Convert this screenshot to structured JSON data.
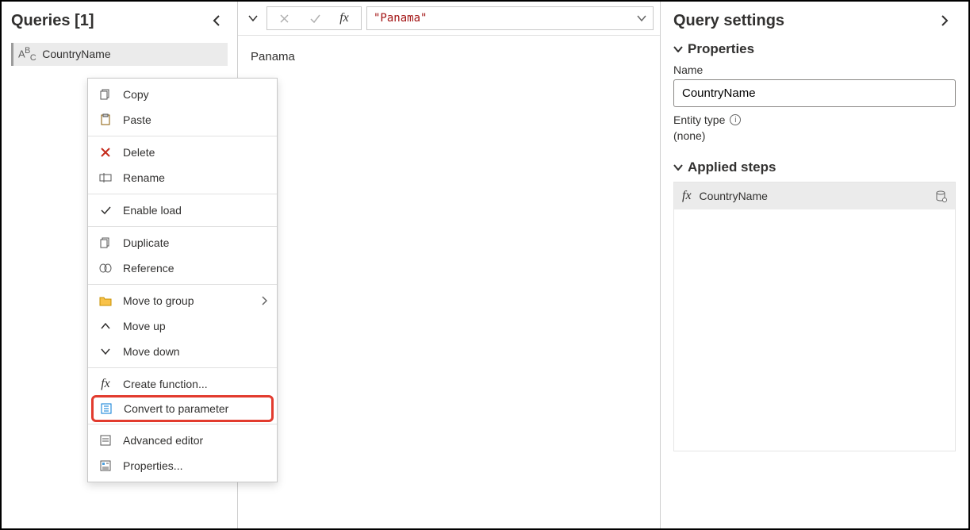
{
  "queries": {
    "title": "Queries [1]",
    "items": [
      {
        "label": "CountryName"
      }
    ]
  },
  "context_menu": {
    "copy": "Copy",
    "paste": "Paste",
    "delete": "Delete",
    "rename": "Rename",
    "enable_load": "Enable load",
    "duplicate": "Duplicate",
    "reference": "Reference",
    "move_to_group": "Move to group",
    "move_up": "Move up",
    "move_down": "Move down",
    "create_function": "Create function...",
    "convert_to_parameter": "Convert to parameter",
    "advanced_editor": "Advanced editor",
    "properties": "Properties..."
  },
  "formula_bar": {
    "text": "\"Panama\""
  },
  "preview": {
    "value": "Panama"
  },
  "settings": {
    "title": "Query settings",
    "properties_label": "Properties",
    "name_label": "Name",
    "name_value": "CountryName",
    "entity_type_label": "Entity type",
    "entity_type_value": "(none)",
    "applied_steps_label": "Applied steps",
    "steps": [
      {
        "label": "CountryName"
      }
    ]
  }
}
